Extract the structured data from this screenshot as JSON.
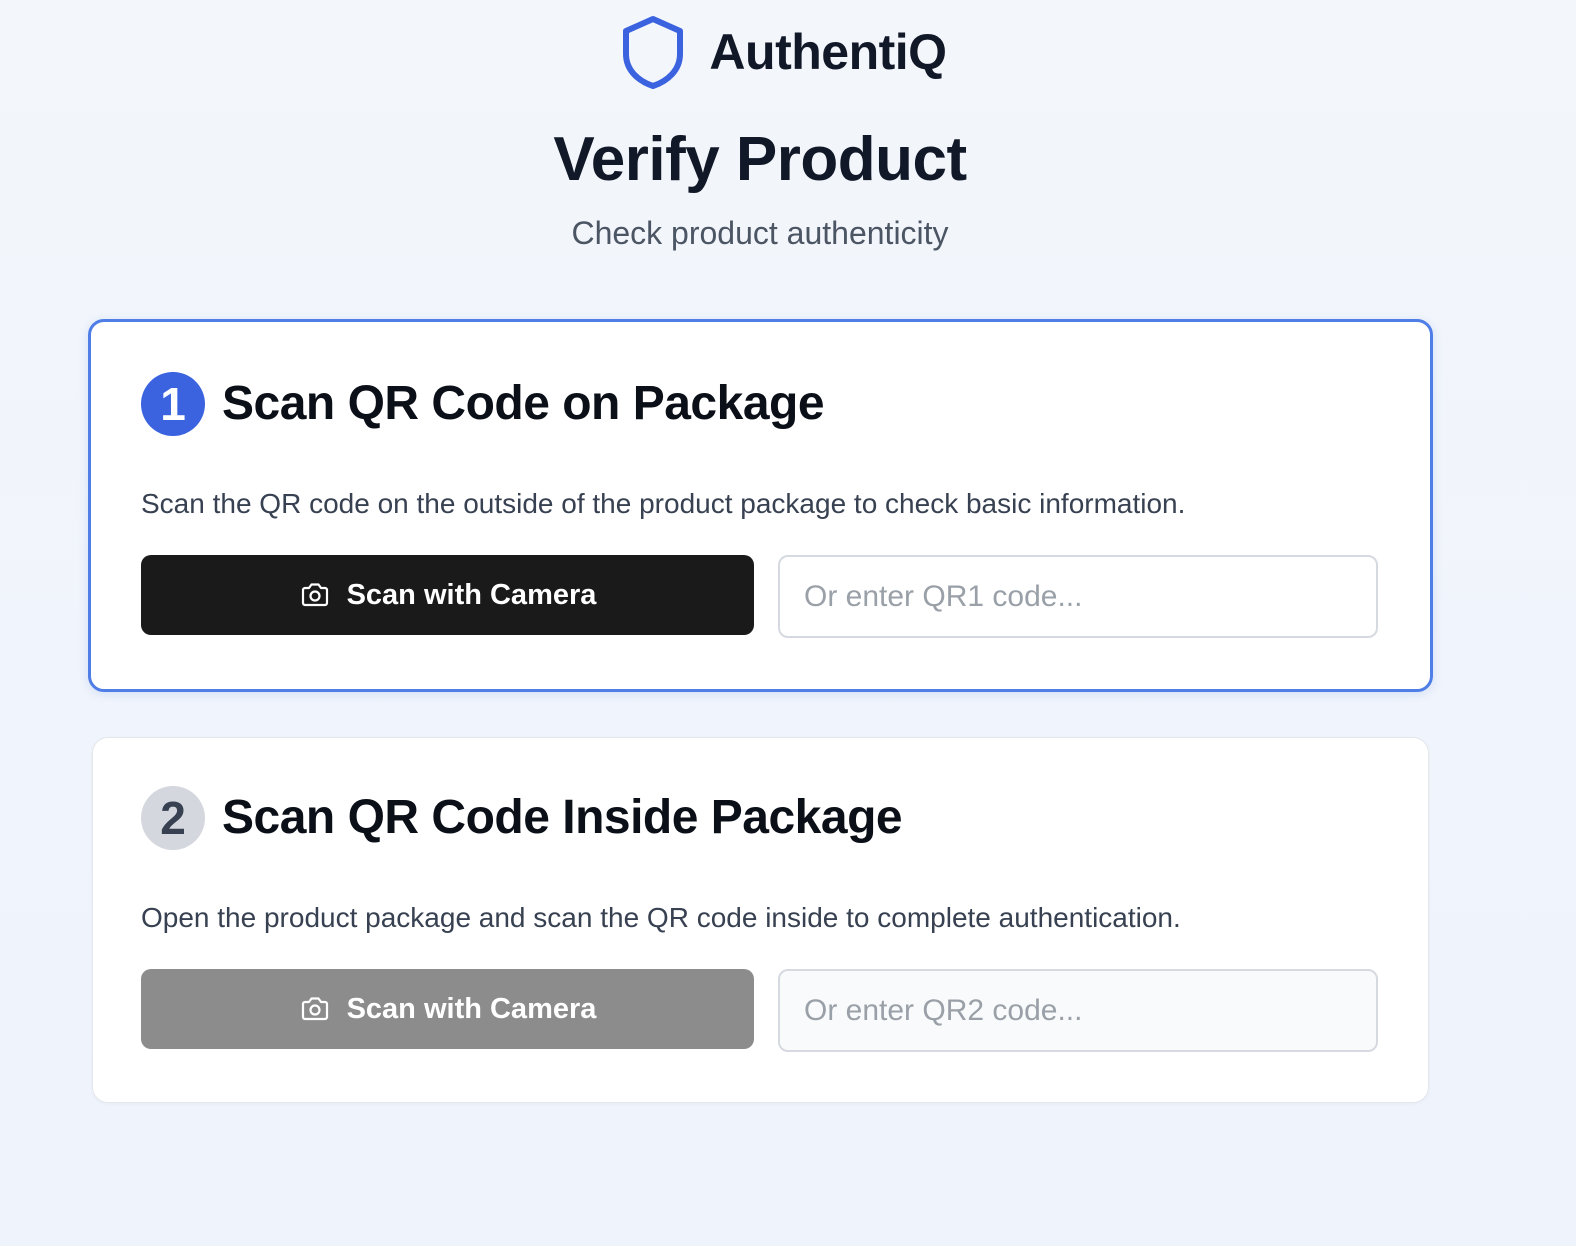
{
  "brand": {
    "name": "AuthentiQ",
    "logo_icon": "shield-icon",
    "accent_color": "#3b63e0"
  },
  "page": {
    "title": "Verify Product",
    "subtitle": "Check product authenticity"
  },
  "steps": [
    {
      "number": "1",
      "title": "Scan QR Code on Package",
      "description": "Scan the QR code on the outside of the product package to check basic information.",
      "scan_button_label": "Scan with Camera",
      "scan_button_icon": "camera-icon",
      "input_placeholder": "Or enter QR1 code...",
      "input_value": "",
      "state": "active"
    },
    {
      "number": "2",
      "title": "Scan QR Code Inside Package",
      "description": "Open the product package and scan the QR code inside to complete authentication.",
      "scan_button_label": "Scan with Camera",
      "scan_button_icon": "camera-icon",
      "input_placeholder": "Or enter QR2 code...",
      "input_value": "",
      "state": "disabled"
    }
  ],
  "colors": {
    "active_border": "#4f7ee6",
    "active_button": "#1a1a1a",
    "disabled_button": "#8c8c8c",
    "inactive_badge": "#d4d8de"
  }
}
